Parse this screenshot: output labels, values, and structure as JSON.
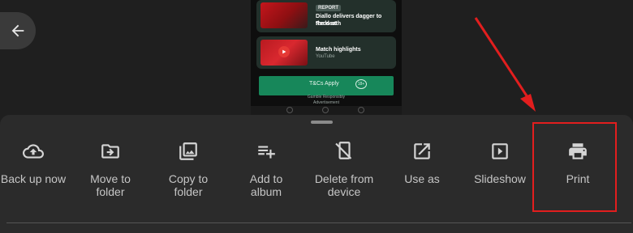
{
  "viewer": {
    "news_cards": [
      {
        "badge": "REPORT",
        "title_line1": "Diallo delivers dagger to Reds at",
        "title_line2": "the death"
      },
      {
        "title": "Match highlights",
        "source": "YouTube"
      }
    ],
    "ad": {
      "cta": "T&Cs Apply",
      "age_badge": "18+",
      "note": "Gamble Responsibly",
      "label": "Advertisement"
    }
  },
  "actions": [
    {
      "id": "backup",
      "label_line1": "Back up now",
      "label_line2": "",
      "icon": "cloud-upload-icon"
    },
    {
      "id": "move",
      "label_line1": "Move to",
      "label_line2": "folder",
      "icon": "folder-move-icon"
    },
    {
      "id": "copy",
      "label_line1": "Copy to",
      "label_line2": "folder",
      "icon": "photo-library-icon"
    },
    {
      "id": "album",
      "label_line1": "Add to",
      "label_line2": "album",
      "icon": "playlist-add-icon"
    },
    {
      "id": "delete",
      "label_line1": "Delete from",
      "label_line2": "device",
      "icon": "delete-from-device-icon"
    },
    {
      "id": "useas",
      "label_line1": "Use as",
      "label_line2": "",
      "icon": "open-in-new-icon"
    },
    {
      "id": "slideshow",
      "label_line1": "Slideshow",
      "label_line2": "",
      "icon": "slideshow-icon"
    },
    {
      "id": "print",
      "label_line1": "Print",
      "label_line2": "",
      "icon": "print-icon"
    }
  ],
  "colors": {
    "background": "#1f1f1f",
    "sheet": "#2b2b2b",
    "text": "#c6c6c6",
    "icon": "#d5d5d5",
    "annotation": "#e21e1e"
  }
}
